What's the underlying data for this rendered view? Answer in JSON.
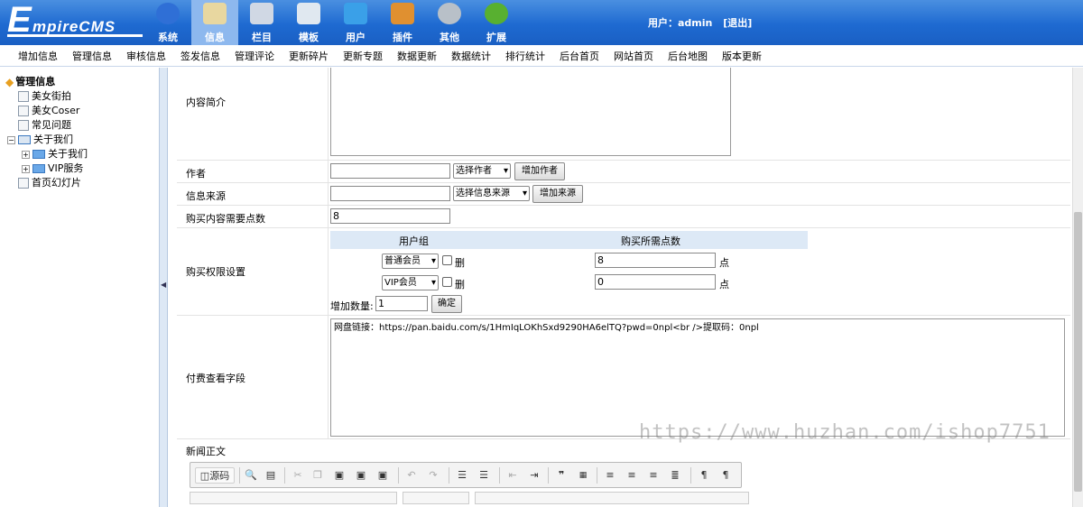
{
  "brand": {
    "logo_first": "E",
    "logo_rest": "mpireCMS"
  },
  "topnav": [
    {
      "label": "系统",
      "icon": "globe-icon",
      "color": "#2f6fd6"
    },
    {
      "label": "信息",
      "icon": "document-edit-icon",
      "color": "#e8d7a0"
    },
    {
      "label": "栏目",
      "icon": "folder-icon",
      "color": "#d0d8e4"
    },
    {
      "label": "模板",
      "icon": "window-icon",
      "color": "#e0e8f0"
    },
    {
      "label": "用户",
      "icon": "user-icon",
      "color": "#3aa0e8"
    },
    {
      "label": "插件",
      "icon": "tools-icon",
      "color": "#e09030"
    },
    {
      "label": "其他",
      "icon": "gear-icon",
      "color": "#b8c0c8"
    },
    {
      "label": "扩展",
      "icon": "plus-circle-icon",
      "color": "#58b030"
    }
  ],
  "user": {
    "label": "用户：admin",
    "logout": "[退出]"
  },
  "subnav": [
    "增加信息",
    "管理信息",
    "审核信息",
    "签发信息",
    "管理评论",
    "更新碎片",
    "更新专题",
    "数据更新",
    "数据统计",
    "排行统计",
    "后台首页",
    "网站首页",
    "后台地图",
    "版本更新"
  ],
  "tree": {
    "root": "管理信息",
    "items": [
      "美女街拍",
      "美女Coser",
      "常见问题"
    ],
    "group": "关于我们",
    "children": [
      "关于我们",
      "VIP服务"
    ],
    "last": "首页幻灯片"
  },
  "form": {
    "summary_label": "内容简介",
    "author_label": "作者",
    "author_select": "选择作者",
    "author_add": "增加作者",
    "source_label": "信息来源",
    "source_select": "选择信息来源",
    "source_add": "增加来源",
    "points_label": "购买内容需要点数",
    "points_value": "8",
    "perm_label": "购买权限设置",
    "perm_col_group": "用户组",
    "perm_col_points": "购买所需点数",
    "perm_rows": [
      {
        "group": "普通会员",
        "del": "删",
        "points": "8",
        "unit": "点"
      },
      {
        "group": "VIP会员",
        "del": "删",
        "points": "0",
        "unit": "点"
      }
    ],
    "add_count_label": "增加数量:",
    "add_count_value": "1",
    "confirm": "确定",
    "paid_label": "付费查看字段",
    "paid_value": "网盘链接：https://pan.baidu.com/s/1HmIqLOKhSxd9290HA6elTQ?pwd=0npl<br />提取码：0npl",
    "body_label": "新闻正文",
    "source_button": "源码"
  },
  "watermark": "https://www.huzhan.com/ishop7751"
}
